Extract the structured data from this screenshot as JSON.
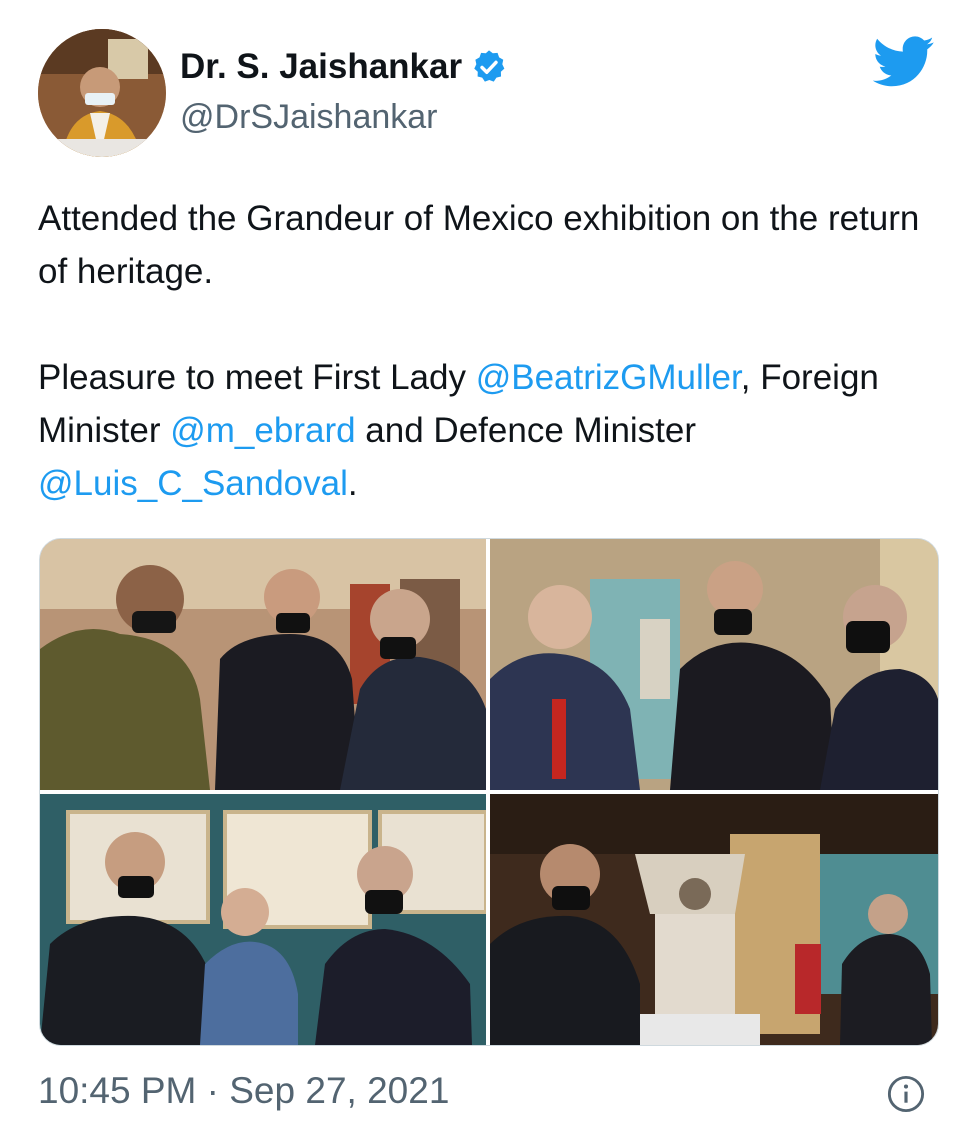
{
  "author": {
    "display_name": "Dr. S. Jaishankar",
    "handle": "@DrSJaishankar",
    "verified_icon": "verified-badge-icon",
    "brand_icon": "twitter-bird-icon"
  },
  "tweet": {
    "line1": "Attended the Grandeur of Mexico exhibition on the return of heritage.",
    "p2_part1": "Pleasure to meet First Lady ",
    "mention1": "@BeatrizGMuller",
    "p2_part2": ", Foreign Minister ",
    "mention2": "@m_ebrard",
    "p2_part3": " and Defence Minister ",
    "mention3": "@Luis_C_Sandoval",
    "p2_part4": "."
  },
  "media": {
    "photo_count": 4
  },
  "meta": {
    "timestamp": "10:45 PM · Sep 27, 2021",
    "info_icon": "info-icon"
  },
  "colors": {
    "accent": "#1d9bf0",
    "secondary_text": "#536471",
    "primary_text": "#0f1419"
  }
}
